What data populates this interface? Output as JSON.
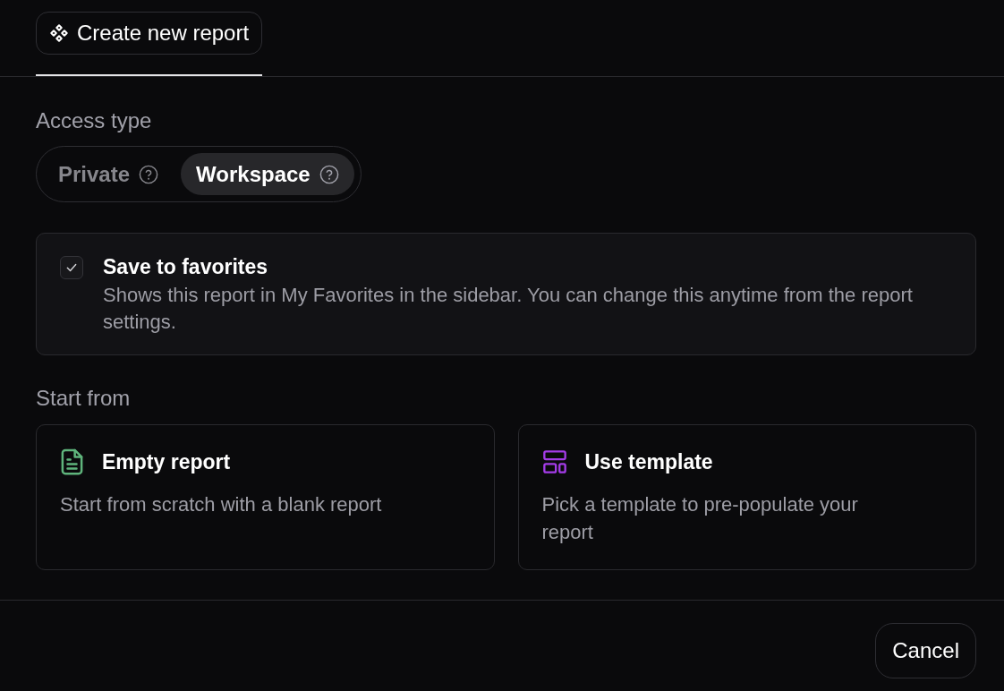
{
  "tabs": [
    {
      "label": "Create new report",
      "selected": true
    }
  ],
  "access_type": {
    "label": "Access type",
    "options": [
      {
        "label": "Private",
        "selected": false
      },
      {
        "label": "Workspace",
        "selected": true
      }
    ]
  },
  "favorites": {
    "title": "Save to favorites",
    "description": "Shows this report in My Favorites in the sidebar. You can change this anytime from the report settings.",
    "checked": true
  },
  "start_from": {
    "label": "Start from",
    "options": [
      {
        "kind": "empty",
        "title": "Empty report",
        "description": "Start from scratch with a blank report"
      },
      {
        "kind": "template",
        "title": "Use template",
        "description": "Pick a template to pre-populate your report"
      }
    ]
  },
  "footer": {
    "buttons": [
      "Cancel"
    ]
  }
}
